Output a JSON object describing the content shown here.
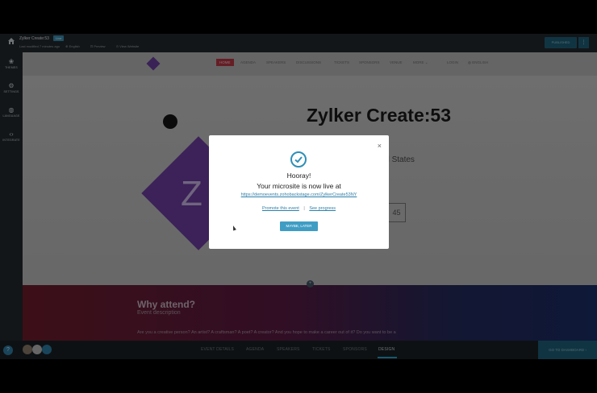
{
  "topbar": {
    "title": "Zylker Create:53",
    "status": "Live",
    "last_modified": "Last modified 7 minutes ago",
    "language": "English",
    "preview": "Preview",
    "view_website": "View Website",
    "publish_label": "PUBLISHED",
    "more_label": "⋮"
  },
  "rail": [
    {
      "label": "THEMES",
      "icon": "palette-icon",
      "glyph": "❀"
    },
    {
      "label": "SETTINGS",
      "icon": "gear-icon",
      "glyph": "⚙"
    },
    {
      "label": "LANGUAGE",
      "icon": "globe-icon",
      "glyph": "◍"
    },
    {
      "label": "INTEGRATE",
      "icon": "code-icon",
      "glyph": "‹›"
    }
  ],
  "site": {
    "nav": [
      "HOME",
      "AGENDA",
      "SPEAKERS",
      "DISCUSSIONS",
      "TICKETS",
      "SPONSORS",
      "VENUE",
      "MORE ⌄",
      "LOGIN",
      "ENGLISH"
    ],
    "hero_title": "Zylker Create:53",
    "hero_location": "k - United States",
    "hero_z": "Z",
    "countdown": "45",
    "why_title": "Why attend?",
    "why_sub": "Event description",
    "why_body": "Are you a creative person? An artist? A craftsman? A poet? A creator? And you hope to make a career out of it? Do you want to be a"
  },
  "bottombar": {
    "help": "?",
    "tabs": [
      "EVENT DETAILS",
      "AGENDA",
      "SPEAKERS",
      "TICKETS",
      "SPONSORS",
      "DESIGN"
    ],
    "active_tab": "DESIGN",
    "dashboard": "GO TO DASHBOARD  ›"
  },
  "modal": {
    "close": "×",
    "heading": "Hooray!",
    "message": "Your microsite is now live at",
    "url": "https://demoevents.zohobackstage.com/ZylkerCreate53NY",
    "promote": "Promote this event",
    "separator": "|",
    "progress": "See progress",
    "button": "MAYBE, LATER"
  },
  "colors": {
    "accent": "#3f9dc4",
    "nav_active": "#b83745",
    "purple": "#6d3fa3"
  }
}
